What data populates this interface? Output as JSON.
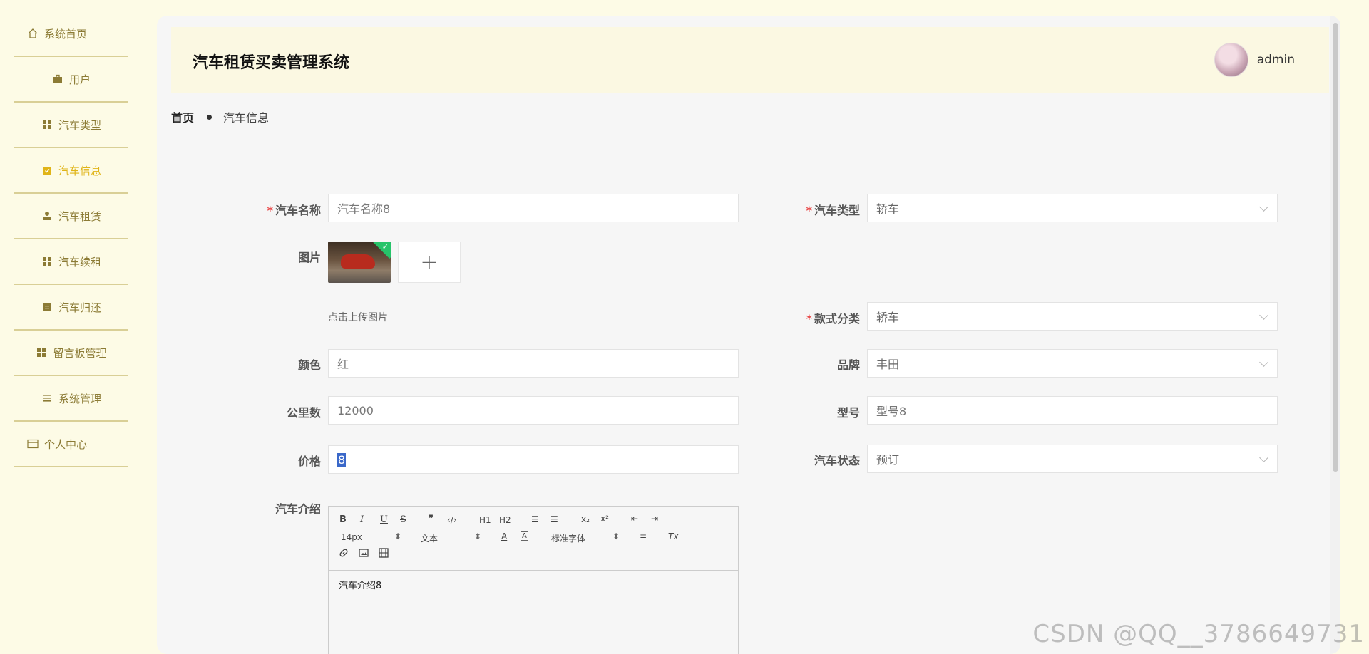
{
  "sidebar": {
    "items": [
      {
        "label": "系统首页",
        "icon": "home-icon"
      },
      {
        "label": "用户",
        "icon": "briefcase-icon"
      },
      {
        "label": "汽车类型",
        "icon": "grid-icon"
      },
      {
        "label": "汽车信息",
        "icon": "clipboard-check-icon",
        "active": true
      },
      {
        "label": "汽车租赁",
        "icon": "stamp-icon"
      },
      {
        "label": "汽车续租",
        "icon": "grid-icon"
      },
      {
        "label": "汽车归还",
        "icon": "clipboard-icon"
      },
      {
        "label": "留言板管理",
        "icon": "grid-icon"
      },
      {
        "label": "系统管理",
        "icon": "list-icon"
      },
      {
        "label": "个人中心",
        "icon": "card-icon"
      }
    ]
  },
  "header": {
    "title": "汽车租赁买卖管理系统",
    "username": "admin"
  },
  "breadcrumb": {
    "home": "首页",
    "current": "汽车信息"
  },
  "form": {
    "car_name": {
      "label": "汽车名称",
      "value": "汽车名称8"
    },
    "car_type": {
      "label": "汽车类型",
      "value": "轿车"
    },
    "image": {
      "label": "图片",
      "hint": "点击上传图片",
      "add": "+"
    },
    "style": {
      "label": "款式分类",
      "value": "轿车"
    },
    "color": {
      "label": "颜色",
      "value": "红"
    },
    "brand": {
      "label": "品牌",
      "value": "丰田"
    },
    "mileage": {
      "label": "公里数",
      "value": "12000"
    },
    "model": {
      "label": "型号",
      "value": "型号8"
    },
    "price": {
      "label": "价格",
      "value": "8"
    },
    "status": {
      "label": "汽车状态",
      "value": "预订"
    },
    "intro": {
      "label": "汽车介绍",
      "content": "汽车介绍8",
      "toolbar": {
        "bold": "B",
        "italic": "I",
        "underline": "U",
        "strike": "S",
        "quote": "❞",
        "code": "‹/›",
        "h1": "H1",
        "h2": "H2",
        "ol": "☰",
        "ul": "☰",
        "sub": "x₂",
        "sup": "x²",
        "indent_less": "⇤",
        "indent_more": "⇥",
        "size": "14px",
        "header": "文本",
        "font": "标准字体",
        "color": "A",
        "bg": "A",
        "align": "≡",
        "clear": "Tx",
        "link": "🔗",
        "image": "▣",
        "video": "▦"
      }
    }
  },
  "watermark": "CSDN @QQ__3786649731"
}
